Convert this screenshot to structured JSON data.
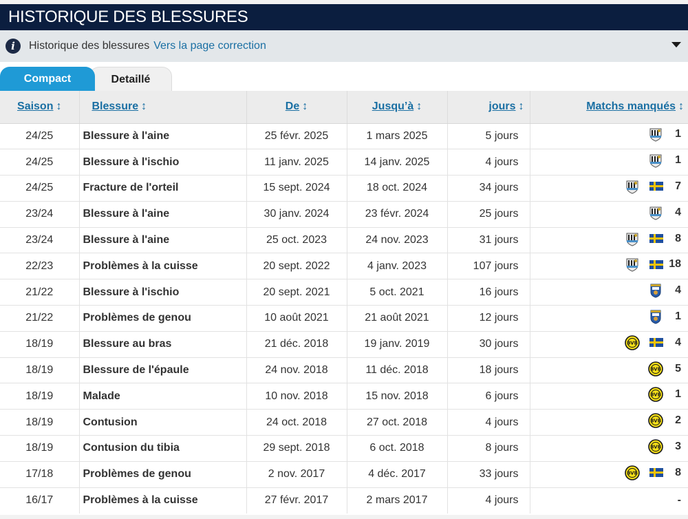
{
  "page_title": "HISTORIQUE DES BLESSURES",
  "info_bar": {
    "icon": "info-icon",
    "text": "Historique des blessures",
    "link": "Vers la page correction",
    "toggle_icon": "chevron-down-icon"
  },
  "tabs": [
    {
      "label": "Compact",
      "active": true
    },
    {
      "label": "Detaillé",
      "active": false
    }
  ],
  "table": {
    "sort_glyph": "↕",
    "headers": {
      "season": "Saison",
      "injury": "Blessure",
      "from": "De",
      "until": "Jusqu’à",
      "days": "jours",
      "games": "Matchs manqués"
    },
    "rows": [
      {
        "season": "24/25",
        "injury": "Blessure à l'aine",
        "from": "25 févr. 2025",
        "until": "1 mars 2025",
        "days": "5 jours",
        "teams": [
          "newcastle"
        ],
        "games": "1"
      },
      {
        "season": "24/25",
        "injury": "Blessure à l'ischio",
        "from": "11 janv. 2025",
        "until": "14 janv. 2025",
        "days": "4 jours",
        "teams": [
          "newcastle"
        ],
        "games": "1"
      },
      {
        "season": "24/25",
        "injury": "Fracture de l'orteil",
        "from": "15 sept. 2024",
        "until": "18 oct. 2024",
        "days": "34 jours",
        "teams": [
          "newcastle",
          "sweden"
        ],
        "games": "7"
      },
      {
        "season": "23/24",
        "injury": "Blessure à l'aine",
        "from": "30 janv. 2024",
        "until": "23 févr. 2024",
        "days": "25 jours",
        "teams": [
          "newcastle"
        ],
        "games": "4"
      },
      {
        "season": "23/24",
        "injury": "Blessure à l'aine",
        "from": "25 oct. 2023",
        "until": "24 nov. 2023",
        "days": "31 jours",
        "teams": [
          "newcastle",
          "sweden"
        ],
        "games": "8"
      },
      {
        "season": "22/23",
        "injury": "Problèmes à la cuisse",
        "from": "20 sept. 2022",
        "until": "4 janv. 2023",
        "days": "107 jours",
        "teams": [
          "newcastle",
          "sweden"
        ],
        "games": "18"
      },
      {
        "season": "21/22",
        "injury": "Blessure à l'ischio",
        "from": "20 sept. 2021",
        "until": "5 oct. 2021",
        "days": "16 jours",
        "teams": [
          "real-sociedad"
        ],
        "games": "4"
      },
      {
        "season": "21/22",
        "injury": "Problèmes de genou",
        "from": "10 août 2021",
        "until": "21 août 2021",
        "days": "12 jours",
        "teams": [
          "real-sociedad"
        ],
        "games": "1"
      },
      {
        "season": "18/19",
        "injury": "Blessure au bras",
        "from": "21 déc. 2018",
        "until": "19 janv. 2019",
        "days": "30 jours",
        "teams": [
          "dortmund",
          "sweden"
        ],
        "games": "4"
      },
      {
        "season": "18/19",
        "injury": "Blessure de l'épaule",
        "from": "24 nov. 2018",
        "until": "11 déc. 2018",
        "days": "18 jours",
        "teams": [
          "dortmund"
        ],
        "games": "5"
      },
      {
        "season": "18/19",
        "injury": "Malade",
        "from": "10 nov. 2018",
        "until": "15 nov. 2018",
        "days": "6 jours",
        "teams": [
          "dortmund"
        ],
        "games": "1"
      },
      {
        "season": "18/19",
        "injury": "Contusion",
        "from": "24 oct. 2018",
        "until": "27 oct. 2018",
        "days": "4 jours",
        "teams": [
          "dortmund"
        ],
        "games": "2"
      },
      {
        "season": "18/19",
        "injury": "Contusion du tibia",
        "from": "29 sept. 2018",
        "until": "6 oct. 2018",
        "days": "8 jours",
        "teams": [
          "dortmund"
        ],
        "games": "3"
      },
      {
        "season": "17/18",
        "injury": "Problèmes de genou",
        "from": "2 nov. 2017",
        "until": "4 déc. 2017",
        "days": "33 jours",
        "teams": [
          "dortmund",
          "sweden"
        ],
        "games": "8"
      },
      {
        "season": "16/17",
        "injury": "Problèmes à la cuisse",
        "from": "27 févr. 2017",
        "until": "2 mars 2017",
        "days": "4 jours",
        "teams": [],
        "games": "-"
      }
    ]
  },
  "colors": {
    "header_bg": "#0b1e3f",
    "tab_active": "#1f9ad6",
    "link": "#1a6fa3",
    "info_bg": "#e3e7ea"
  }
}
